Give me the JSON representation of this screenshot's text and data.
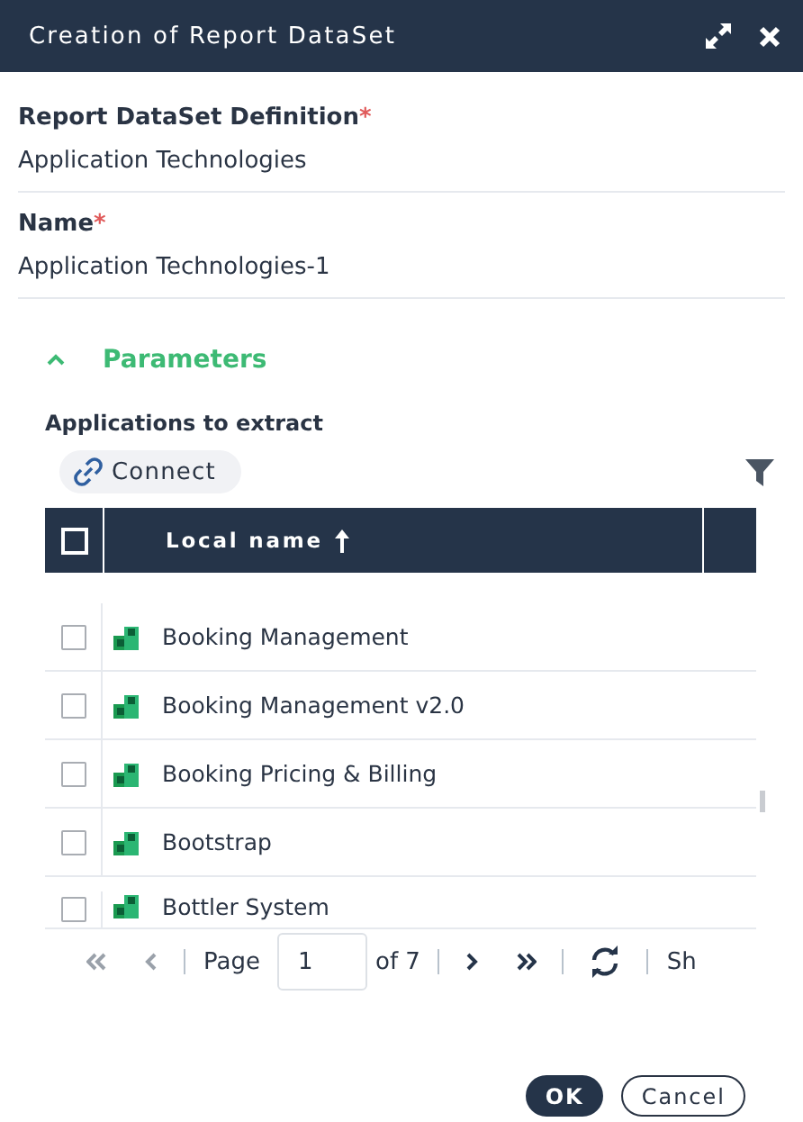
{
  "window": {
    "title": "Creation of Report DataSet"
  },
  "fields": [
    {
      "label": "Report DataSet Definition",
      "required_mark": "*",
      "value": "Application Technologies"
    },
    {
      "label": "Name",
      "required_mark": "*",
      "value": "Application Technologies-1"
    }
  ],
  "parameters": {
    "title": "Parameters",
    "expanded": true,
    "list_label": "Applications to extract",
    "connect_button": "Connect",
    "table": {
      "column": "Local name",
      "sort_ascending": true,
      "header_checked": false,
      "rows": [
        {
          "name": "Booking Management",
          "selected": false
        },
        {
          "name": "Booking Management v2.0",
          "selected": false
        },
        {
          "name": "Booking Pricing & Billing",
          "selected": false
        },
        {
          "name": "Bootstrap",
          "selected": false
        },
        {
          "name": "Bottler System",
          "selected": false
        }
      ]
    }
  },
  "pagination": {
    "page_label": "Page",
    "page": "1",
    "of_label": "of 7",
    "cut_label": "Sh"
  },
  "buttons": [
    {
      "label": "OK",
      "kind": "primary"
    },
    {
      "label": "Cancel",
      "kind": "secondary"
    }
  ]
}
